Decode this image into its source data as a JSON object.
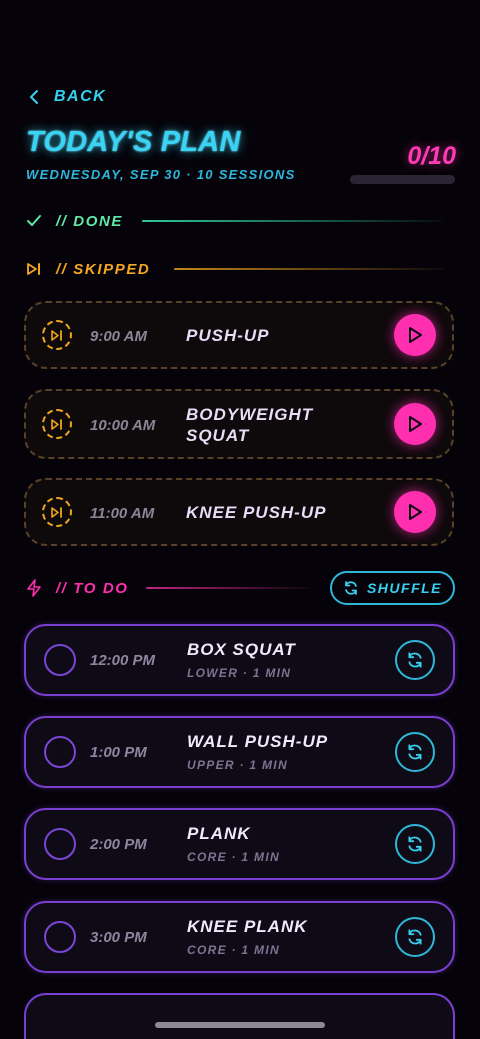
{
  "header": {
    "back_label": "BACK",
    "title": "TODAY'S PLAN",
    "subtitle": "WEDNESDAY, SEP 30 · 10 SESSIONS",
    "progress_text": "0/10",
    "progress_fraction": 0
  },
  "sections": {
    "done": {
      "label": "// DONE",
      "color": "#5fe8a8",
      "icon": "check-icon"
    },
    "skipped": {
      "label": "// SKIPPED",
      "color": "#f5a623",
      "icon": "skip-forward-icon"
    },
    "todo": {
      "label": "// TO DO",
      "color": "#ff2fb0",
      "icon": "lightning-icon"
    }
  },
  "skipped_items": [
    {
      "time": "9:00 AM",
      "name": "PUSH-UP"
    },
    {
      "time": "10:00 AM",
      "name": "BODYWEIGHT SQUAT"
    },
    {
      "time": "11:00 AM",
      "name": "KNEE PUSH-UP"
    }
  ],
  "shuffle_label": "SHUFFLE",
  "todo_items": [
    {
      "time": "12:00 PM",
      "name": "BOX SQUAT",
      "meta": "LOWER · 1 MIN"
    },
    {
      "time": "1:00 PM",
      "name": "WALL PUSH-UP",
      "meta": "UPPER · 1 MIN"
    },
    {
      "time": "2:00 PM",
      "name": "PLANK",
      "meta": "CORE · 1 MIN"
    },
    {
      "time": "3:00 PM",
      "name": "KNEE PLANK",
      "meta": "CORE · 1 MIN"
    }
  ],
  "colors": {
    "accent_cyan": "#39d3f5",
    "accent_pink": "#ff2fb0",
    "accent_orange": "#f0a619",
    "accent_purple": "#7a3ed2"
  }
}
